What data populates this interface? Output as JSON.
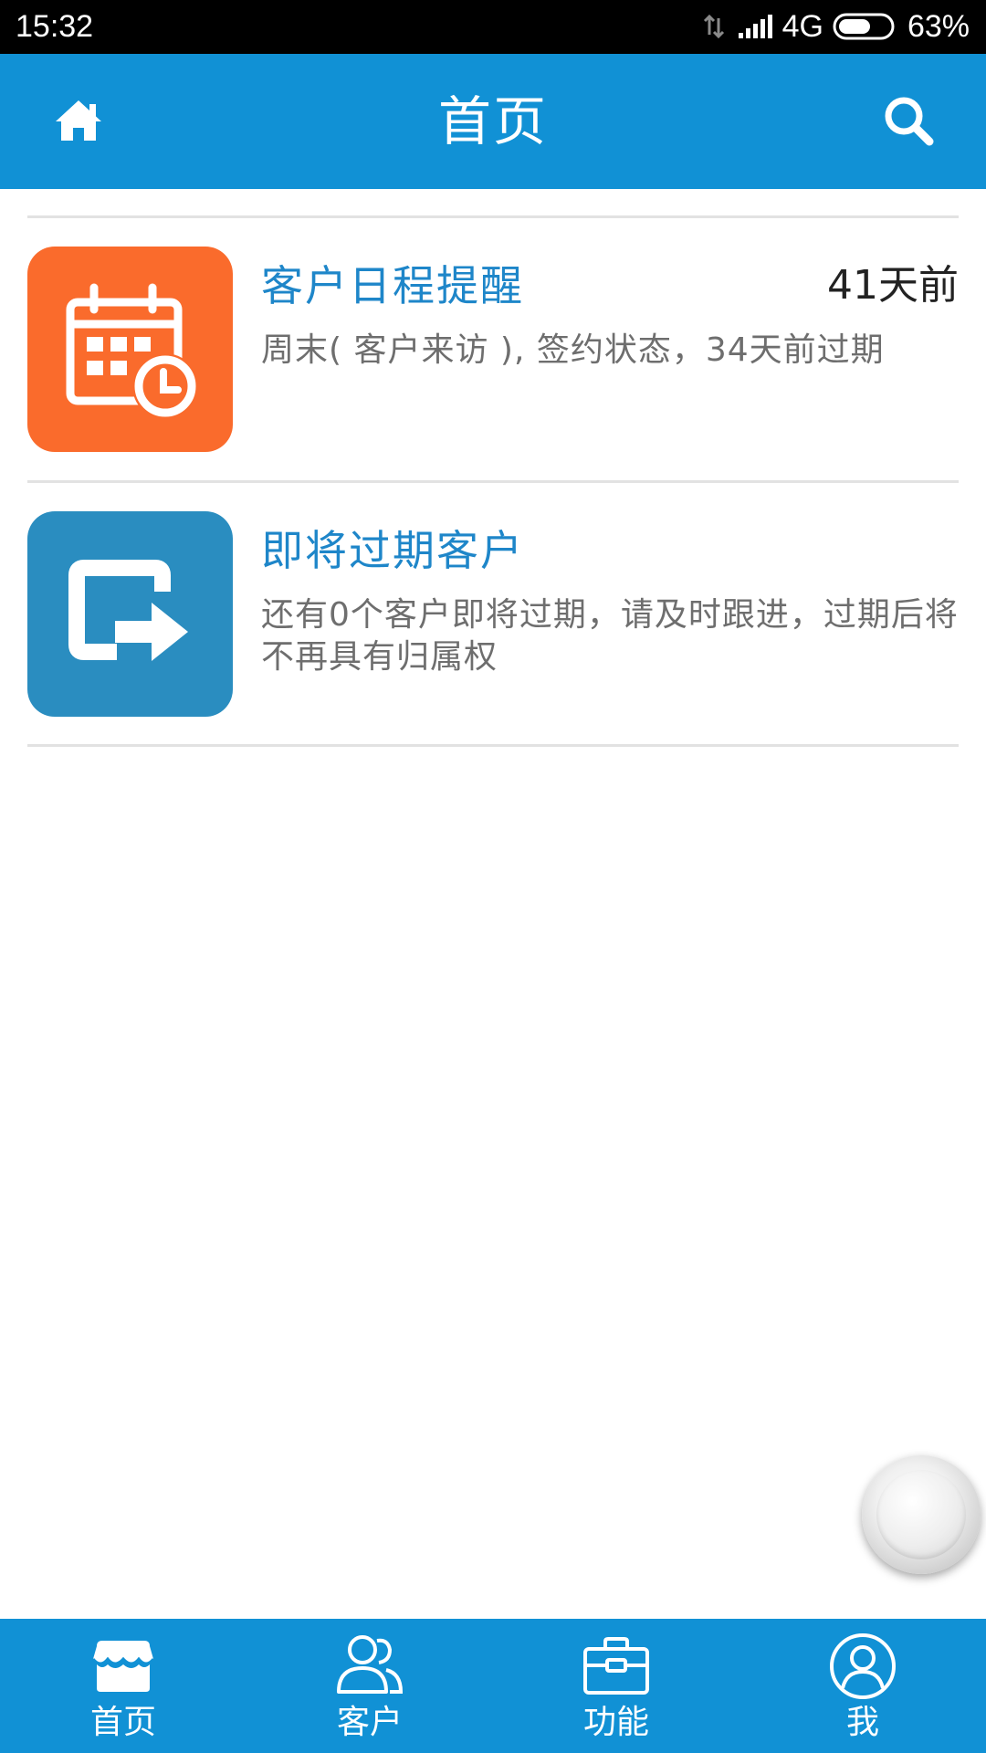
{
  "status_bar": {
    "time": "15:32",
    "network": "4G",
    "battery": "63%",
    "battery_level": 0.63,
    "icons": [
      "data-arrows-icon",
      "signal-icon",
      "battery-icon"
    ]
  },
  "header": {
    "title": "首页",
    "left_icon": "home-icon",
    "right_icon": "search-icon"
  },
  "cards": [
    {
      "title": "客户日程提醒",
      "time": "41天前",
      "description": "周末( 客户来访 ), 签约状态，34天前过期",
      "icon": "calendar-clock-icon",
      "icon_bg": "#fa6b2c"
    },
    {
      "title": "即将过期客户",
      "time": "",
      "description": "还有0个客户即将过期，请及时跟进，过期后将不再具有归属权",
      "icon": "exit-arrow-icon",
      "icon_bg": "#2a8dc0"
    }
  ],
  "bottom_nav": {
    "items": [
      {
        "label": "首页",
        "icon": "store-icon"
      },
      {
        "label": "客户",
        "icon": "customers-icon"
      },
      {
        "label": "功能",
        "icon": "briefcase-icon"
      },
      {
        "label": "我",
        "icon": "profile-icon"
      }
    ]
  },
  "colors": {
    "primary": "#1191d5",
    "title_blue": "#1e86c9",
    "orange": "#fa6b2c",
    "icon_blue": "#2a8dc0"
  }
}
